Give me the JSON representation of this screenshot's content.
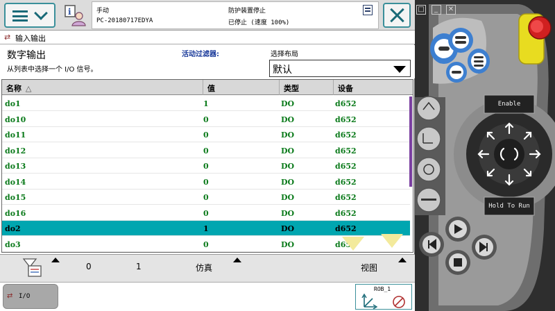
{
  "header": {
    "mode": "手动",
    "controller": "PC-20180717EDYA",
    "safety": "防护装置停止",
    "run_state": "已停止 (速度 100%)"
  },
  "title_bar": {
    "label": "输入输出"
  },
  "page": {
    "title": "数字输出",
    "subtitle": "从列表中选择一个 I/O 信号。",
    "filter_label": "活动过滤器:",
    "layout_label": "选择布局",
    "layout_value": "默认"
  },
  "table": {
    "columns": [
      "名称",
      "值",
      "类型",
      "设备"
    ],
    "rows": [
      [
        "do1",
        "1",
        "DO",
        "d652"
      ],
      [
        "do10",
        "0",
        "DO",
        "d652"
      ],
      [
        "do11",
        "0",
        "DO",
        "d652"
      ],
      [
        "do12",
        "0",
        "DO",
        "d652"
      ],
      [
        "do13",
        "0",
        "DO",
        "d652"
      ],
      [
        "do14",
        "0",
        "DO",
        "d652"
      ],
      [
        "do15",
        "0",
        "DO",
        "d652"
      ],
      [
        "do16",
        "0",
        "DO",
        "d652"
      ],
      [
        "do2",
        "1",
        "DO",
        "d652"
      ],
      [
        "do3",
        "0",
        "DO",
        "d652"
      ]
    ],
    "selected_row_index": 8,
    "sort_indicator": "△"
  },
  "bottom_nav": {
    "zero_label": "0",
    "one_label": "1",
    "simulate_label": "仿真",
    "view_label": "视图"
  },
  "taskbar": {
    "io_label": "I/O",
    "rob_label": "ROB_1"
  },
  "pendant": {
    "enable_label": "Enable",
    "hold_to_run_label": "Hold To Run"
  },
  "colors": {
    "accent": "#00a6b0",
    "signal_text": "#0a7a1a",
    "filter_label": "#1a3a9a",
    "pendant_yellow": "#e8dc20",
    "pendant_red": "#d02020",
    "pendant_blue": "#3d7fd0"
  }
}
